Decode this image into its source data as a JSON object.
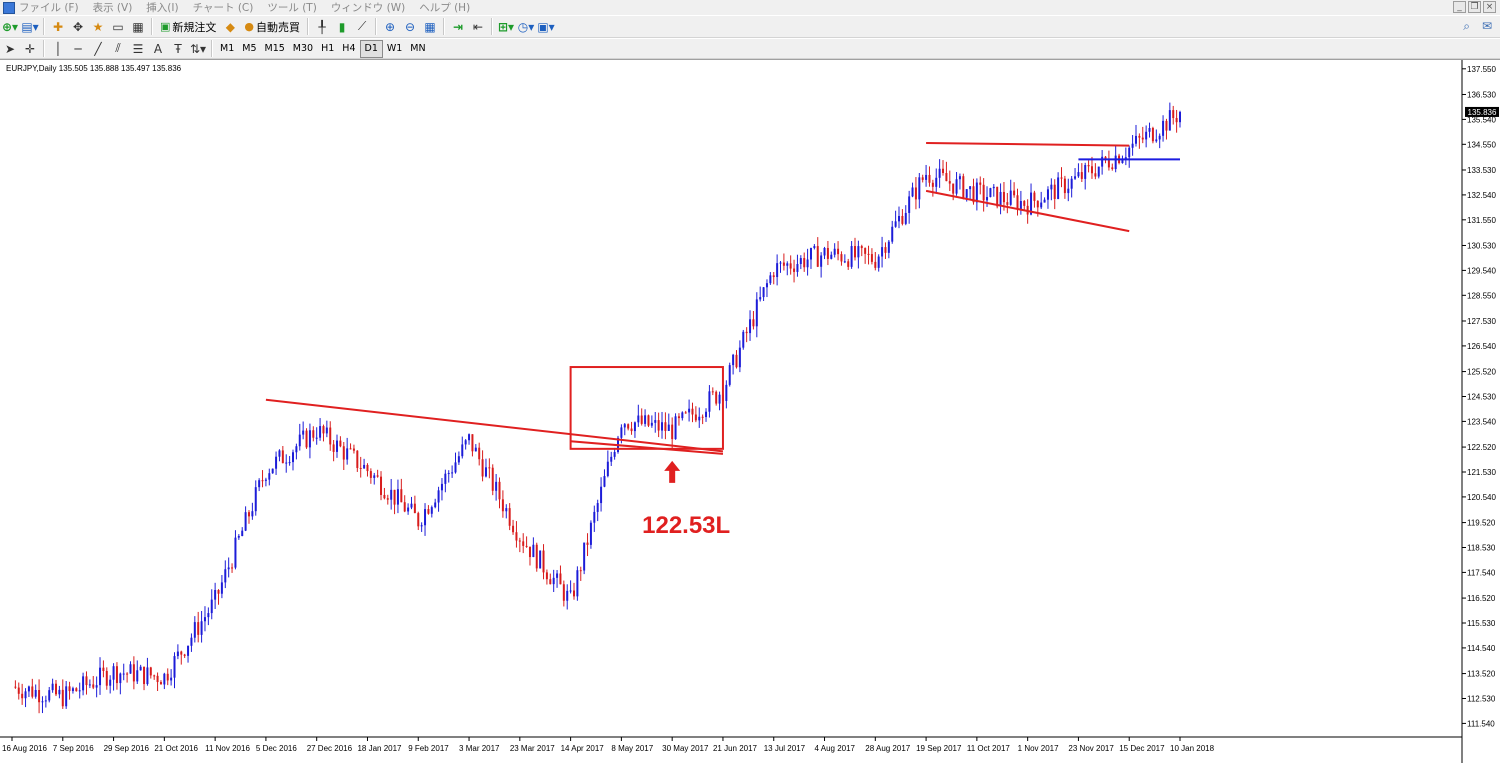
{
  "menu": [
    "ファイル (F)",
    "表示 (V)",
    "挿入(I)",
    "チャート (C)",
    "ツール (T)",
    "ウィンドウ (W)",
    "ヘルプ (H)"
  ],
  "toolbar": {
    "new_order": "新規注文",
    "auto_trade": "自動売買"
  },
  "timeframes": [
    "M1",
    "M5",
    "M15",
    "M30",
    "H1",
    "H4",
    "D1",
    "W1",
    "MN"
  ],
  "active_timeframe": "D1",
  "chart_header": "EURJPY,Daily  135.505 135.888 135.497 135.836",
  "current_price": "135.836",
  "annotation": "122.53L",
  "colors": {
    "bull": "#1c1cd8",
    "bear": "#d81c1c",
    "annotation": "#e02020",
    "marker": "#1c1ce0"
  },
  "chart_data": {
    "type": "candlestick",
    "symbol": "EURJPY",
    "timeframe": "Daily",
    "ylim": [
      111.0,
      137.9
    ],
    "y_ticks": [
      "137.550",
      "136.530",
      "135.540",
      "134.550",
      "133.530",
      "132.540",
      "131.550",
      "130.530",
      "129.540",
      "128.550",
      "127.530",
      "126.540",
      "125.520",
      "124.530",
      "123.540",
      "122.520",
      "121.530",
      "120.540",
      "119.520",
      "118.530",
      "117.540",
      "116.520",
      "115.530",
      "114.540",
      "113.520",
      "112.530",
      "111.540"
    ],
    "x_ticks": [
      "16 Aug 2016",
      "7 Sep 2016",
      "29 Sep 2016",
      "21 Oct 2016",
      "11 Nov 2016",
      "5 Dec 2016",
      "27 Dec 2016",
      "18 Jan 2017",
      "9 Feb 2017",
      "3 Mar 2017",
      "23 Mar 2017",
      "14 Apr 2017",
      "8 May 2017",
      "30 May 2017",
      "21 Jun 2017",
      "13 Jul 2017",
      "4 Aug 2017",
      "28 Aug 2017",
      "19 Sep 2017",
      "11 Oct 2017",
      "1 Nov 2017",
      "23 Nov 2017",
      "15 Dec 2017",
      "10 Jan 2018"
    ],
    "anchors": [
      [
        "16 Aug 2016",
        113.0
      ],
      [
        "7 Sep 2016",
        112.6
      ],
      [
        "29 Sep 2016",
        113.6
      ],
      [
        "21 Oct 2016",
        113.4
      ],
      [
        "11 Nov 2016",
        116.4
      ],
      [
        "5 Dec 2016",
        121.6
      ],
      [
        "27 Dec 2016",
        123.2
      ],
      [
        "18 Jan 2017",
        121.6
      ],
      [
        "9 Feb 2017",
        119.6
      ],
      [
        "3 Mar 2017",
        122.8
      ],
      [
        "23 Mar 2017",
        119.0
      ],
      [
        "14 Apr 2017",
        116.4
      ],
      [
        "8 May 2017",
        123.6
      ],
      [
        "30 May 2017",
        123.2
      ],
      [
        "21 Jun 2017",
        124.8
      ],
      [
        "13 Jul 2017",
        129.6
      ],
      [
        "4 Aug 2017",
        130.2
      ],
      [
        "28 Aug 2017",
        130.0
      ],
      [
        "19 Sep 2017",
        133.4
      ],
      [
        "11 Oct 2017",
        132.6
      ],
      [
        "1 Nov 2017",
        132.2
      ],
      [
        "23 Nov 2017",
        133.2
      ],
      [
        "15 Dec 2017",
        134.4
      ],
      [
        "10 Jan 2018",
        135.8
      ]
    ],
    "last": {
      "open": 135.505,
      "high": 135.888,
      "low": 135.497,
      "close": 135.836
    },
    "annotations": {
      "trendlines": [
        {
          "from": [
            "5 Dec 2016",
            124.4
          ],
          "to": [
            "21 Jun 2017",
            122.35
          ]
        },
        {
          "from": [
            "14 Apr 2017",
            122.75
          ],
          "to": [
            "21 Jun 2017",
            122.25
          ]
        },
        {
          "from": [
            "19 Sep 2017",
            132.7
          ],
          "to": [
            "15 Dec 2017",
            131.1
          ]
        },
        {
          "from": [
            "19 Sep 2017",
            134.6
          ],
          "to": [
            "15 Dec 2017",
            134.5
          ]
        }
      ],
      "box": {
        "from": [
          "14 Apr 2017",
          125.7
        ],
        "to": [
          "21 Jun 2017",
          122.45
        ]
      },
      "hline": {
        "from": [
          "23 Nov 2017",
          133.95
        ],
        "to": [
          "10 Jan 2018",
          133.95
        ]
      },
      "arrow_at": [
        "30 May 2017",
        122.53
      ]
    }
  }
}
